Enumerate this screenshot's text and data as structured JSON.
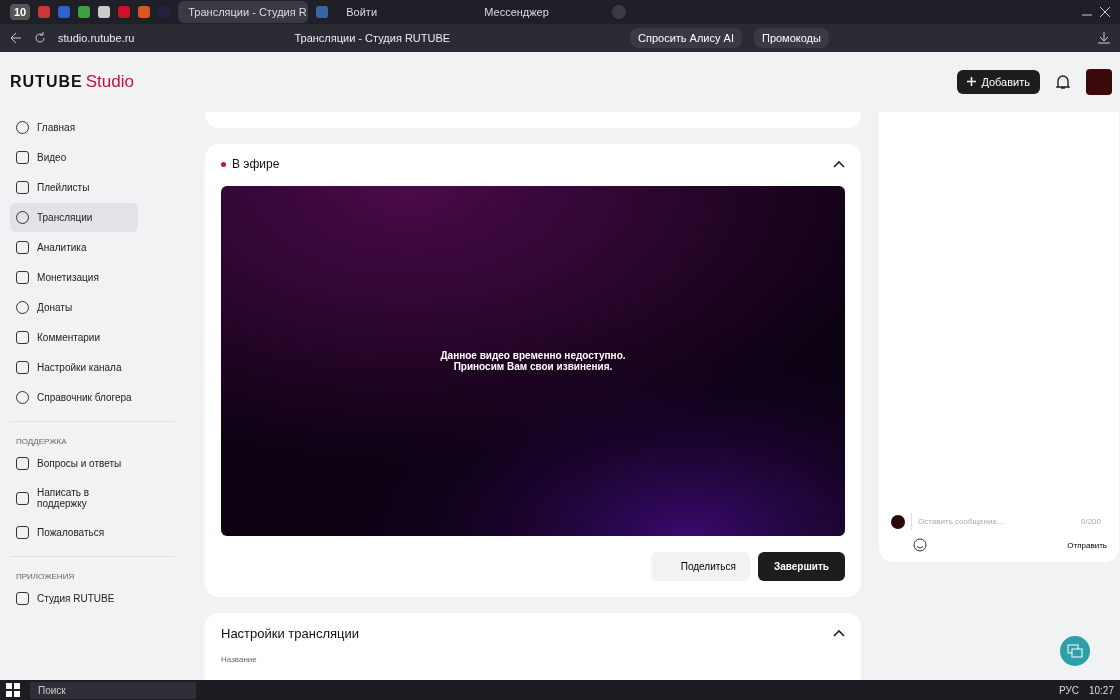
{
  "browser": {
    "tabs": [
      {
        "kind": "counter",
        "label": "10",
        "selected": false
      },
      {
        "kind": "icon",
        "selected": false
      },
      {
        "kind": "icon",
        "selected": false
      },
      {
        "kind": "icon",
        "selected": false
      },
      {
        "kind": "icon",
        "selected": false
      },
      {
        "kind": "icon",
        "selected": false
      },
      {
        "kind": "icon",
        "selected": false
      },
      {
        "kind": "icon",
        "selected": false
      },
      {
        "kind": "page",
        "label": "Трансляции - Студия R",
        "selected": true
      },
      {
        "kind": "icon",
        "selected": false
      },
      {
        "kind": "page",
        "label": "Войти",
        "selected": false
      },
      {
        "kind": "page",
        "label": "Мессенджер",
        "selected": false
      }
    ],
    "url": "studio.rutube.ru",
    "page_title": "Трансляции - Студия RUTUBE",
    "alice": "Спросить Алису AI",
    "promo": "Промокоды"
  },
  "header": {
    "logo": "RUTUBE",
    "logo_suffix": "Studio",
    "add_button": "Добавить"
  },
  "sidebar": {
    "items": [
      {
        "label": "Главная",
        "selected": false
      },
      {
        "label": "Видео",
        "selected": false
      },
      {
        "label": "Плейлисты",
        "selected": false
      },
      {
        "label": "Трансляции",
        "selected": true
      },
      {
        "label": "Аналитика",
        "selected": false
      },
      {
        "label": "Монетизация",
        "selected": false
      },
      {
        "label": "Донаты",
        "selected": false
      },
      {
        "label": "Комментарии",
        "selected": false
      },
      {
        "label": "Настройки канала",
        "selected": false
      },
      {
        "label": "Справочник блогера",
        "selected": false
      }
    ],
    "sections": [
      {
        "title": "ПОДДЕРЖКА",
        "items": [
          {
            "label": "Вопросы и ответы",
            "selected": false
          },
          {
            "label": "Написать в поддержку",
            "selected": false
          },
          {
            "label": "Пожаловаться",
            "selected": false
          }
        ]
      },
      {
        "title": "ПРИЛОЖЕНИЯ",
        "items": [
          {
            "label": "Студия RUTUBE",
            "selected": false
          }
        ]
      }
    ]
  },
  "live": {
    "title": "В эфире",
    "expanded": true,
    "video_message": [
      "Данное видео временно недоступно.",
      "Приносим Вам свои извинения."
    ],
    "share": "Поделиться",
    "finish": "Завершить"
  },
  "settings": {
    "title": "Настройки трансляции",
    "expanded": true,
    "field_label": "Название"
  },
  "chat": {
    "placeholder": "Оставить сообщение...",
    "counter": "0/200",
    "send": "Отправить"
  },
  "taskbar": {
    "search": "Поиск",
    "lang": "РУС",
    "time": "10:27"
  }
}
